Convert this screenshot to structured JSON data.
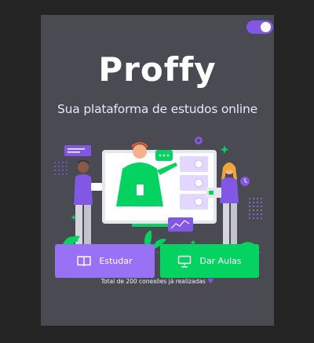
{
  "app": {
    "logo_text": "Proffy",
    "tagline": "Sua plataforma de estudos online"
  },
  "theme_toggle": {
    "state": "on",
    "color": "#8257e5"
  },
  "actions": {
    "study_label": "Estudar",
    "teach_label": "Dar Aulas",
    "study_icon": "book-icon",
    "teach_icon": "presentation-icon",
    "study_color": "#9871f5",
    "teach_color": "#04d361"
  },
  "footer": {
    "connections_text": "Total de 200 conexões já realizadas",
    "heart_icon": "purple-heart-icon"
  },
  "colors": {
    "background": "#4a4a53",
    "accent": "#8257e5",
    "green": "#04d361"
  }
}
